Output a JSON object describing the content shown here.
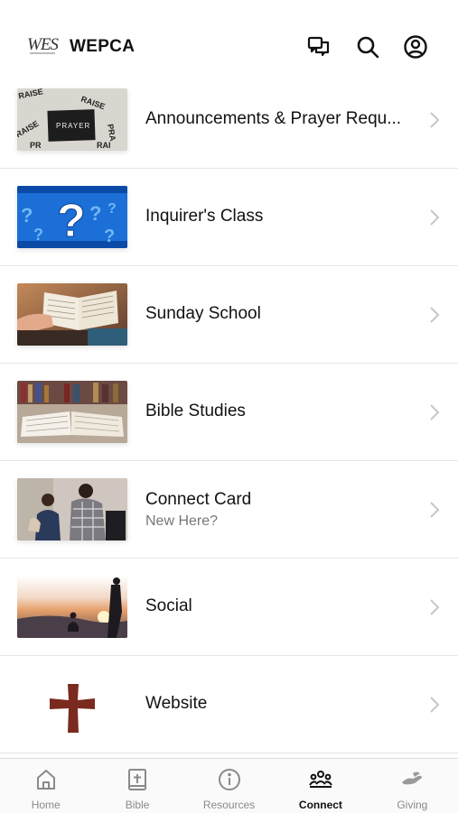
{
  "header": {
    "logo_text": "WES",
    "title": "WEPCA",
    "icons": [
      "chat-icon",
      "search-icon",
      "profile-icon"
    ]
  },
  "items": [
    {
      "label": "Announcements & Prayer Requ...",
      "sub": "",
      "thumb": "prayer-image"
    },
    {
      "label": "Inquirer's Class",
      "sub": "",
      "thumb": "question-mark-image"
    },
    {
      "label": "Sunday School",
      "sub": "",
      "thumb": "open-bible-hands-image"
    },
    {
      "label": "Bible Studies",
      "sub": "",
      "thumb": "open-bible-library-image"
    },
    {
      "label": "Connect Card",
      "sub": "New Here?",
      "thumb": "people-talking-image"
    },
    {
      "label": "Social",
      "sub": "",
      "thumb": "sunset-silhouettes-image"
    },
    {
      "label": "Website",
      "sub": "",
      "thumb": "cross-logo-image"
    }
  ],
  "thumb_text": {
    "prayer": "PRAYER"
  },
  "tabs": [
    {
      "label": "Home",
      "icon": "home-icon",
      "active": false
    },
    {
      "label": "Bible",
      "icon": "bible-icon",
      "active": false
    },
    {
      "label": "Resources",
      "icon": "info-icon",
      "active": false
    },
    {
      "label": "Connect",
      "icon": "people-icon",
      "active": true
    },
    {
      "label": "Giving",
      "icon": "hand-icon",
      "active": false
    }
  ],
  "colors": {
    "accent": "#111111",
    "inactive": "#8a8a8a",
    "cross": "#7a2a1e"
  }
}
